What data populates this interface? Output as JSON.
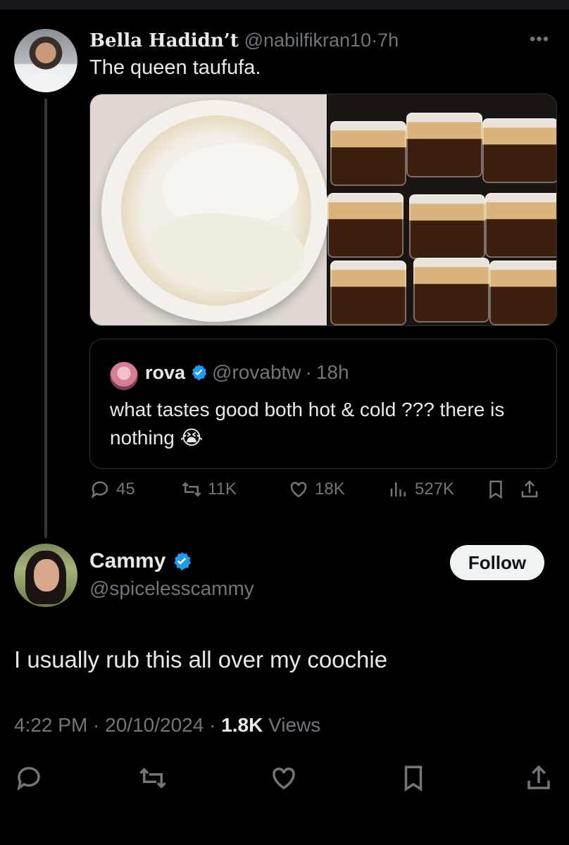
{
  "tweet1": {
    "display_name": "Bella Hadidn’t",
    "handle": "@nabilfikran10",
    "separator": "·",
    "time": "7h",
    "text": "The queen taufufa.",
    "actions": {
      "replies": "45",
      "retweets": "11K",
      "likes": "18K",
      "views": "527K"
    }
  },
  "quote": {
    "display_name": "rova",
    "handle": "@rovabtw",
    "separator": "·",
    "time": "18h",
    "text": "what tastes good both hot & cold ??? there is nothing 😭"
  },
  "tweet2": {
    "display_name": "Cammy",
    "handle": "@spicelesscammy",
    "follow_label": "Follow",
    "text": "I usually rub this all over my coochie",
    "timestamp": "4:22 PM · 20/10/2024 · ",
    "views_count": "1.8K",
    "views_label": " Views"
  },
  "colors": {
    "background": "#000000",
    "text": "#e7e9ea",
    "muted": "#71767b",
    "verified": "#1d9bf0",
    "border": "#2f3336"
  },
  "icons": [
    "more-icon",
    "verified-icon",
    "reply-icon",
    "retweet-icon",
    "like-icon",
    "views-icon",
    "bookmark-icon",
    "share-icon"
  ]
}
